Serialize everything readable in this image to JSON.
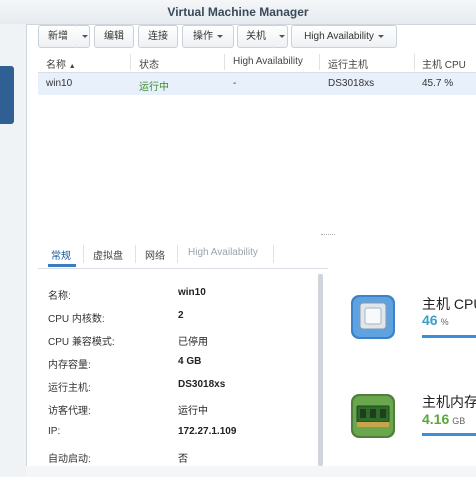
{
  "window": {
    "title": "Virtual Machine Manager"
  },
  "toolbar": {
    "new_label": "新增",
    "edit_label": "编辑",
    "connect_label": "连接",
    "action_label": "操作",
    "shutdown_label": "关机",
    "ha_label": "High Availability"
  },
  "grid": {
    "columns": [
      "名称",
      "状态",
      "High Availability",
      "运行主机",
      "主机 CPU"
    ],
    "rows": [
      {
        "name": "win10",
        "status": "运行中",
        "ha": "-",
        "host": "DS3018xs",
        "cpu": "45.7 %"
      }
    ]
  },
  "detail_tabs": [
    "常规",
    "虚拟盘",
    "网络",
    "High Availability"
  ],
  "properties": [
    {
      "key": "名称:",
      "value": "win10"
    },
    {
      "key": "CPU 内核数:",
      "value": "2"
    },
    {
      "key": "CPU 兼容模式:",
      "value": "已停用"
    },
    {
      "key": "内存容量:",
      "value": "4 GB"
    },
    {
      "key": "运行主机:",
      "value": "DS3018xs"
    },
    {
      "key": "访客代理:",
      "value": "运行中"
    },
    {
      "key": "IP:",
      "value": "172.27.1.109"
    },
    {
      "key": "自动启动:",
      "value": "否"
    }
  ],
  "cards": {
    "cpu": {
      "title": "主机 CPU",
      "value": "46",
      "unit": "%",
      "icon": "cpu-chip-icon"
    },
    "memory": {
      "title": "主机内存",
      "value": "4.16",
      "unit": "GB",
      "icon": "memory-module-icon"
    }
  },
  "colors": {
    "accent": "#3b7bc2",
    "running": "#3a8a2a",
    "selected_row": "#e8f1fb"
  }
}
